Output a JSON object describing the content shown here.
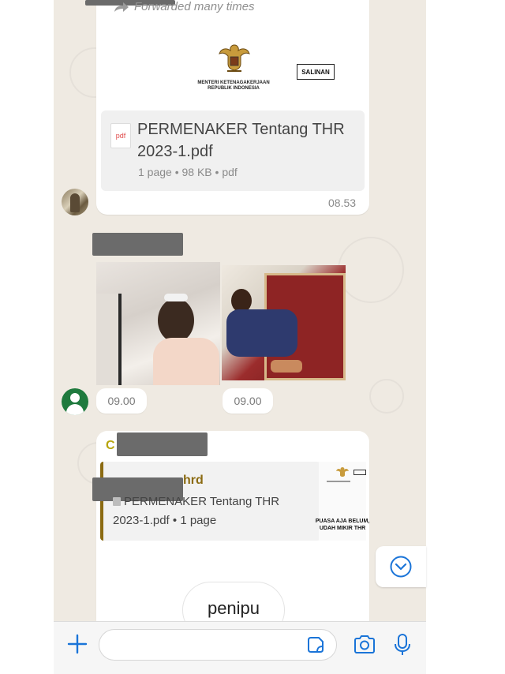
{
  "message1": {
    "forwarded_label": "Forwarded many times",
    "letterhead": {
      "ministry_line1": "MENTERI KETENAGAKERJAAN",
      "ministry_line2": "REPUBLIK INDONESIA",
      "stamp": "SALINAN"
    },
    "document": {
      "icon_label": "pdf",
      "title": "PERMENAKER Tentang THR 2023-1.pdf",
      "meta": "1 page • 98 KB • pdf"
    },
    "time": "08.53"
  },
  "message2": {
    "photo_times": [
      "09.00",
      "09.00"
    ]
  },
  "message3": {
    "sender_initial": "C",
    "quoted": {
      "name": "hrd",
      "text": "PERMENAKER Tentang THR 2023-1.pdf • 1 page",
      "thumb_caption_line1": "PUASA AJA BELUM,",
      "thumb_caption_line2": "UDAH MIKIR THR"
    },
    "reply_text": "penipu"
  },
  "icons": {
    "forward": "forward-arrow-icon",
    "pdf": "pdf-file-icon",
    "scroll_down": "chevron-down-circle-icon",
    "attach": "plus-icon",
    "sticker": "sticker-icon",
    "camera": "camera-icon",
    "mic": "microphone-icon"
  },
  "colors": {
    "accent_blue": "#1a74d8",
    "chat_background": "#efeae2",
    "quote_bar": "#8b6b12",
    "sender_name": "#b7a50b"
  }
}
